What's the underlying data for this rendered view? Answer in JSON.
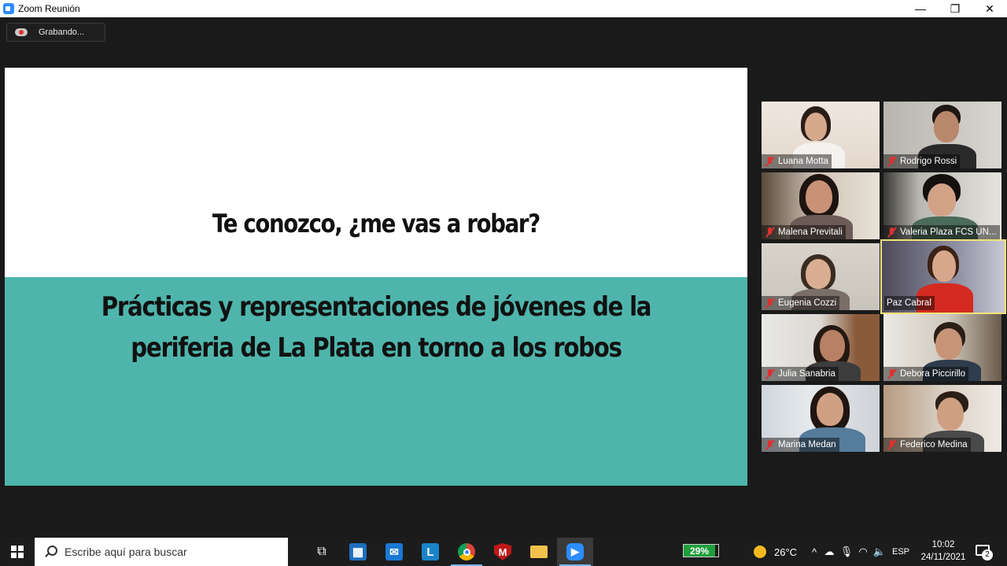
{
  "window": {
    "title": "Zoom Reunión",
    "minimize": "—",
    "restore": "❐",
    "close": "✕"
  },
  "recording": {
    "label": "Grabando..."
  },
  "slide": {
    "title": "Te conozco, ¿me vas a robar?",
    "subtitle_line1": "Prácticas y representaciones de jóvenes de la",
    "subtitle_line2": "periferia de La Plata en torno a los robos"
  },
  "participants": [
    {
      "name": "Luana Motta",
      "muted": true
    },
    {
      "name": "Rodrigo Rossi",
      "muted": true
    },
    {
      "name": "Malena Previtali",
      "muted": true
    },
    {
      "name": "Valeria Plaza FCS UN...",
      "muted": true
    },
    {
      "name": "Eugenia Cozzi",
      "muted": true
    },
    {
      "name": "Paz Cabral",
      "muted": false,
      "speaking": true
    },
    {
      "name": "Julia Sanabria",
      "muted": true
    },
    {
      "name": "Debora Piccirillo",
      "muted": true
    },
    {
      "name": "Marina Medan",
      "muted": true
    },
    {
      "name": "Federico Medina",
      "muted": true
    }
  ],
  "taskbar": {
    "search_placeholder": "Escribe aquí para buscar",
    "apps": [
      "task-view-icon",
      "store-icon",
      "mail-icon",
      "l-app-icon",
      "chrome-icon",
      "mcafee-icon",
      "file-explorer-icon",
      "zoom-icon"
    ],
    "battery": "29%",
    "weather": "26°C",
    "language": "ESP",
    "time": "10:02",
    "date": "24/11/2021",
    "notifications": "2"
  },
  "colors": {
    "slide_teal": "#4fb5ac",
    "speaker_border": "#f0e27a",
    "taskbar": "#1c1c1c",
    "zoom_blue": "#2d8cff"
  }
}
